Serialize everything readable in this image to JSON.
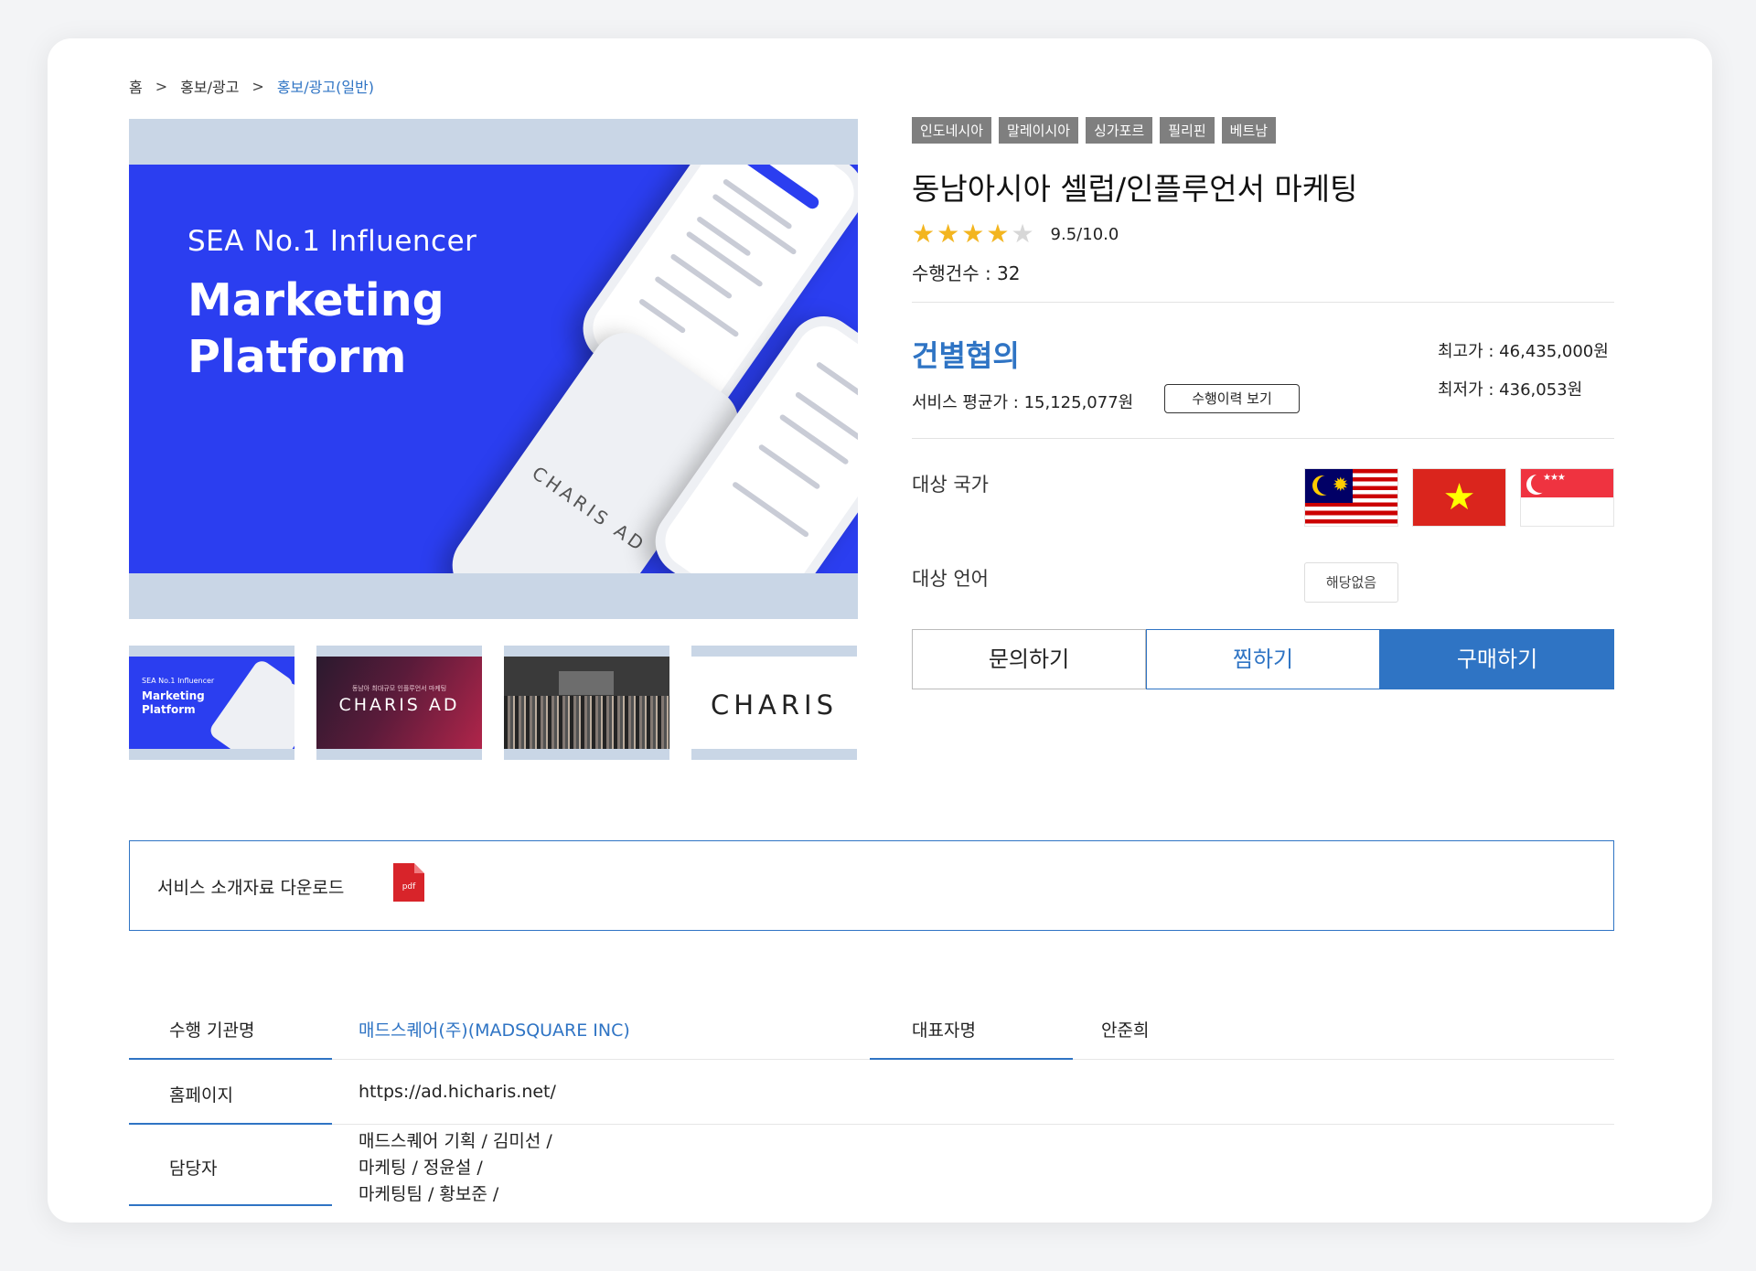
{
  "breadcrumb": {
    "home": "홈",
    "sep1": ">",
    "category": "홍보/광고",
    "sep2": ">",
    "current": "홍보/광고(일반)"
  },
  "main_image": {
    "subtitle": "SEA No.1 Influencer",
    "heading_line1": "Marketing",
    "heading_line2": "Platform",
    "phone_brand": "CHARIS AD"
  },
  "thumbnails": [
    {
      "subtitle": "SEA No.1 Influencer",
      "line1": "Marketing",
      "line2": "Platform"
    },
    {
      "caption": "동남아 최대규모 인플루언서 마케팅",
      "logo": "CHARIS AD"
    },
    {
      "caption": ""
    },
    {
      "logo": "CHARIS"
    }
  ],
  "tags": [
    "인도네시아",
    "말레이시아",
    "싱가포르",
    "필리핀",
    "베트남"
  ],
  "product": {
    "title": "동남아시아 셀럽/인플루언서 마케팅",
    "rating_stars": 4,
    "rating_max": 5,
    "score": "9.5/10.0",
    "count": "수행건수 : 32"
  },
  "price": {
    "main": "건별협의",
    "average": "서비스 평균가 : 15,125,077원",
    "history_button": "수행이력 보기",
    "max": "최고가 : 46,435,000원",
    "min": "최저가 : 436,053원"
  },
  "target": {
    "country_label": "대상 국가",
    "countries": [
      "malaysia-flag",
      "vietnam-flag",
      "singapore-flag"
    ],
    "language_label": "대상 언어",
    "language_value": "해당없음"
  },
  "actions": {
    "inquiry": "문의하기",
    "wish": "찜하기",
    "buy": "구매하기"
  },
  "download": {
    "label": "서비스 소개자료 다운로드",
    "file_type": "pdf"
  },
  "info": {
    "org_label": "수행 기관명",
    "org_value": "매드스퀘어(주)(MADSQUARE INC)",
    "ceo_label": "대표자명",
    "ceo_value": "안준희",
    "homepage_label": "홈페이지",
    "homepage_value": "https://ad.hicharis.net/",
    "contact_label": "담당자",
    "contacts": [
      "매드스퀘어 기획 / 김미선 /",
      "마케팅 / 정윤설 /",
      "마케팅팀 / 황보준 /"
    ]
  },
  "colors": {
    "accent": "#2f74c4",
    "banner": "#2b3ef0",
    "tag": "#7f7f7f",
    "star": "#f3b51f"
  }
}
